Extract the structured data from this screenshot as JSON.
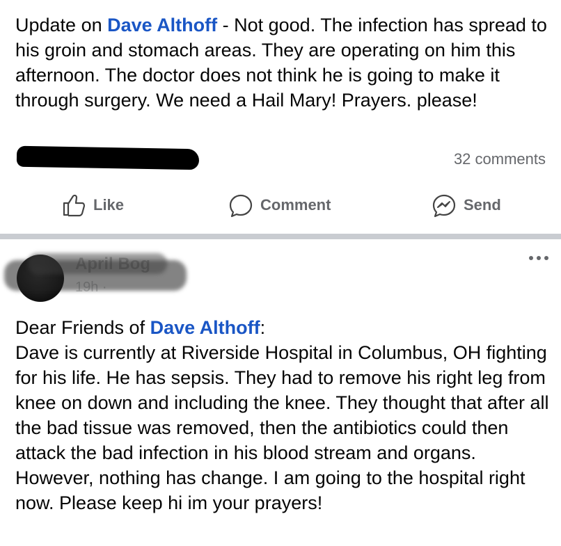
{
  "post1": {
    "prefix": "Update on ",
    "mention": "Dave Althoff",
    "body": " - Not good.  The infection has spread to his groin and stomach areas.  They are operating on him this afternoon.  The doctor does not think he is going to make it through surgery.  We need a Hail Mary! Prayers. please!",
    "comments_count": "32 comments"
  },
  "actions": {
    "like_label": "Like",
    "comment_label": "Comment",
    "send_label": "Send"
  },
  "post2": {
    "author_name": "April Bog",
    "time": "19h ·",
    "greeting_prefix": "Dear Friends of ",
    "mention": "Dave Althoff",
    "greeting_suffix": ":",
    "body": "Dave is currently at Riverside Hospital in Columbus, OH fighting for his life.  He has sepsis. They had to remove his right leg from knee on down and including the knee.  They thought that after all the bad tissue was removed, then the antibiotics could then attack the bad infection in his blood stream and organs. However, nothing has change.  I am going to the hospital right now.  Please keep hi im your prayers!"
  },
  "colors": {
    "mention": "#1a56c5",
    "secondary_text": "#65676b",
    "divider": "#c9ccd1"
  },
  "icons": {
    "like": "thumbs-up-icon",
    "comment": "speech-bubble-icon",
    "send": "messenger-icon",
    "more": "ellipsis-icon"
  }
}
